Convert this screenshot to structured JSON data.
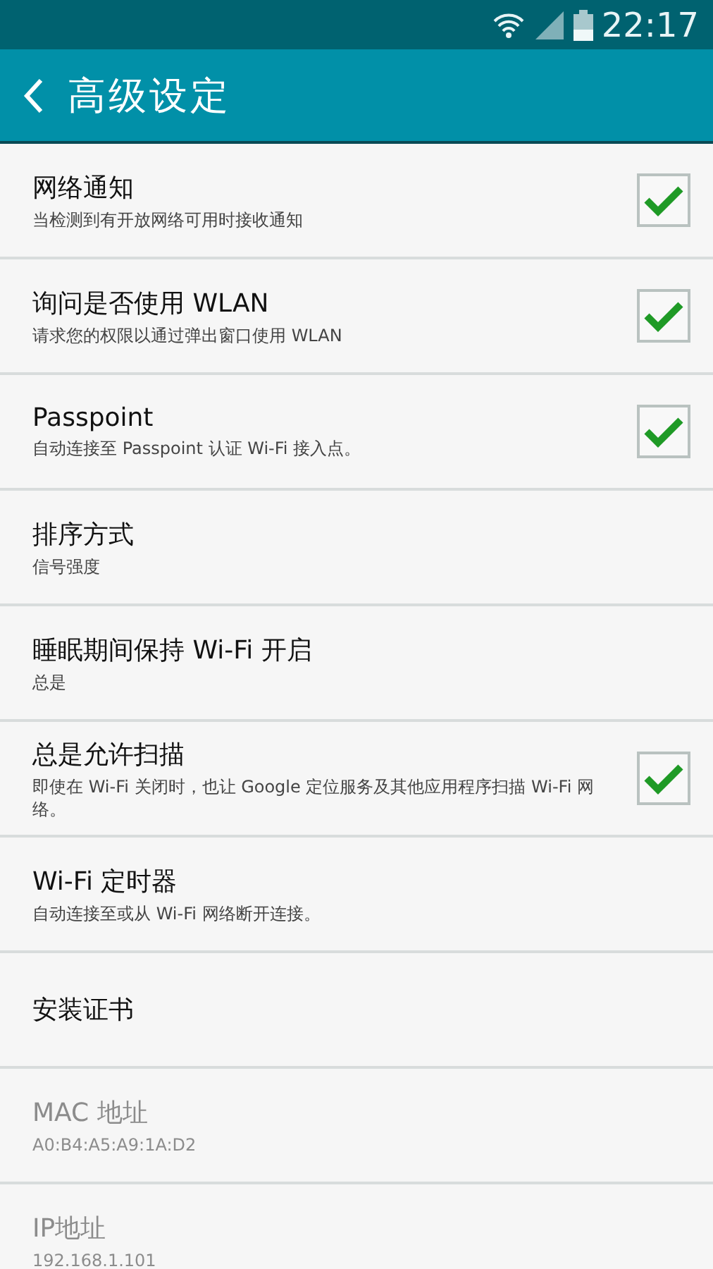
{
  "status_bar": {
    "time": "22:17"
  },
  "toolbar": {
    "title": "高级设定"
  },
  "settings": [
    {
      "kind": "check",
      "title": "网络通知",
      "summary": "当检测到有开放网络可用时接收通知",
      "checked": true,
      "disabled": false
    },
    {
      "kind": "check",
      "title": "询问是否使用 WLAN",
      "summary": "请求您的权限以通过弹出窗口使用 WLAN",
      "checked": true,
      "disabled": false
    },
    {
      "kind": "check",
      "title": "Passpoint",
      "summary": "自动连接至 Passpoint 认证 Wi-Fi 接入点。",
      "checked": true,
      "disabled": false
    },
    {
      "kind": "plain",
      "title": "排序方式",
      "summary": "信号强度",
      "disabled": false
    },
    {
      "kind": "plain",
      "title": "睡眠期间保持 Wi-Fi 开启",
      "summary": "总是",
      "disabled": false
    },
    {
      "kind": "check",
      "title": "总是允许扫描",
      "summary": "即使在 Wi-Fi 关闭时，也让 Google 定位服务及其他应用程序扫描 Wi-Fi 网络。",
      "checked": true,
      "disabled": false
    },
    {
      "kind": "plain",
      "title": "Wi-Fi 定时器",
      "summary": "自动连接至或从 Wi-Fi 网络断开连接。",
      "disabled": false
    },
    {
      "kind": "plain",
      "title": "安装证书",
      "disabled": false
    },
    {
      "kind": "plain",
      "title": "MAC 地址",
      "summary": "A0:B4:A5:A9:1A:D2",
      "disabled": true
    },
    {
      "kind": "plain",
      "title": "IP地址",
      "summary": "192.168.1.101",
      "disabled": true
    }
  ]
}
